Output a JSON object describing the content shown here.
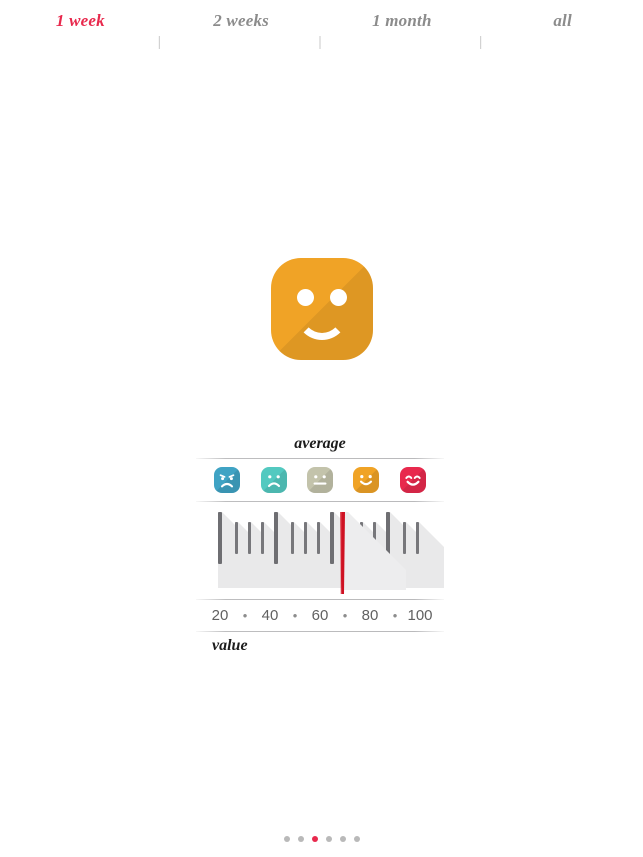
{
  "range_tabs": {
    "separator": "|",
    "items": [
      {
        "label": "1 week",
        "active": true
      },
      {
        "label": "2 weeks",
        "active": false
      },
      {
        "label": "1 month",
        "active": false
      },
      {
        "label": "all",
        "active": false
      }
    ]
  },
  "hero": {
    "icon_name": "smiley-face-icon",
    "color": "#f0a326"
  },
  "card": {
    "title": "average",
    "footer_label": "value",
    "moods": [
      {
        "name": "mood-angry",
        "color": "#3fa3c4"
      },
      {
        "name": "mood-sad",
        "color": "#53c9c0"
      },
      {
        "name": "mood-neutral",
        "color": "#c3c3ab"
      },
      {
        "name": "mood-good",
        "color": "#f0a326"
      },
      {
        "name": "mood-happy",
        "color": "#e8294d"
      }
    ],
    "gauge": {
      "needle_color": "#cf1122",
      "needle_value": 64,
      "scale_separator": "•",
      "scale_labels": [
        "20",
        "40",
        "60",
        "80",
        "100"
      ]
    }
  },
  "page_dots": {
    "count": 6,
    "active_index": 2,
    "active_color": "#e8294d",
    "inactive_color": "#b9b9b9"
  },
  "chart_data": {
    "type": "bar",
    "title": "average",
    "xlabel": "value",
    "categories": [
      "20",
      "40",
      "60",
      "80",
      "100"
    ],
    "values": [
      64
    ],
    "series": [
      {
        "name": "average value",
        "values": [
          64
        ]
      }
    ],
    "xlim": [
      10,
      110
    ],
    "annotations": [
      "needle at ~64"
    ],
    "grid": false,
    "legend": "none"
  }
}
